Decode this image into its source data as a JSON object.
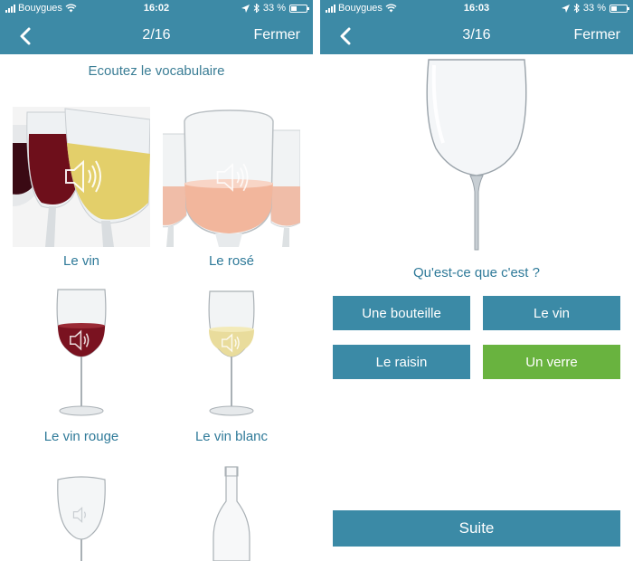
{
  "left_screen": {
    "status": {
      "carrier": "Bouygues",
      "time": "16:02",
      "battery": "33 %"
    },
    "nav": {
      "counter": "2/16",
      "close_label": "Fermer"
    },
    "subtitle": "Ecoutez le vocabulaire",
    "tiles": [
      {
        "caption": "Le vin"
      },
      {
        "caption": "Le rosé"
      },
      {
        "caption": "Le vin rouge"
      },
      {
        "caption": "Le vin blanc"
      }
    ]
  },
  "right_screen": {
    "status": {
      "carrier": "Bouygues",
      "time": "16:03",
      "battery": "33 %"
    },
    "nav": {
      "counter": "3/16",
      "close_label": "Fermer"
    },
    "question": "Qu'est-ce que c'est ?",
    "answers": [
      {
        "label": "Une bouteille",
        "correct": false
      },
      {
        "label": "Le vin",
        "correct": false
      },
      {
        "label": "Le raisin",
        "correct": false
      },
      {
        "label": "Un verre",
        "correct": true
      }
    ],
    "next_label": "Suite"
  },
  "icons": {
    "back": "chevron-left-icon",
    "speaker": "speaker-icon",
    "wifi": "wifi-icon",
    "location": "location-arrow-icon",
    "bluetooth": "bluetooth-icon"
  },
  "colors": {
    "header": "#3d8aa6",
    "text_accent": "#2f7a99",
    "answer_button": "#3b8aa6",
    "correct_answer": "#69b33f"
  }
}
